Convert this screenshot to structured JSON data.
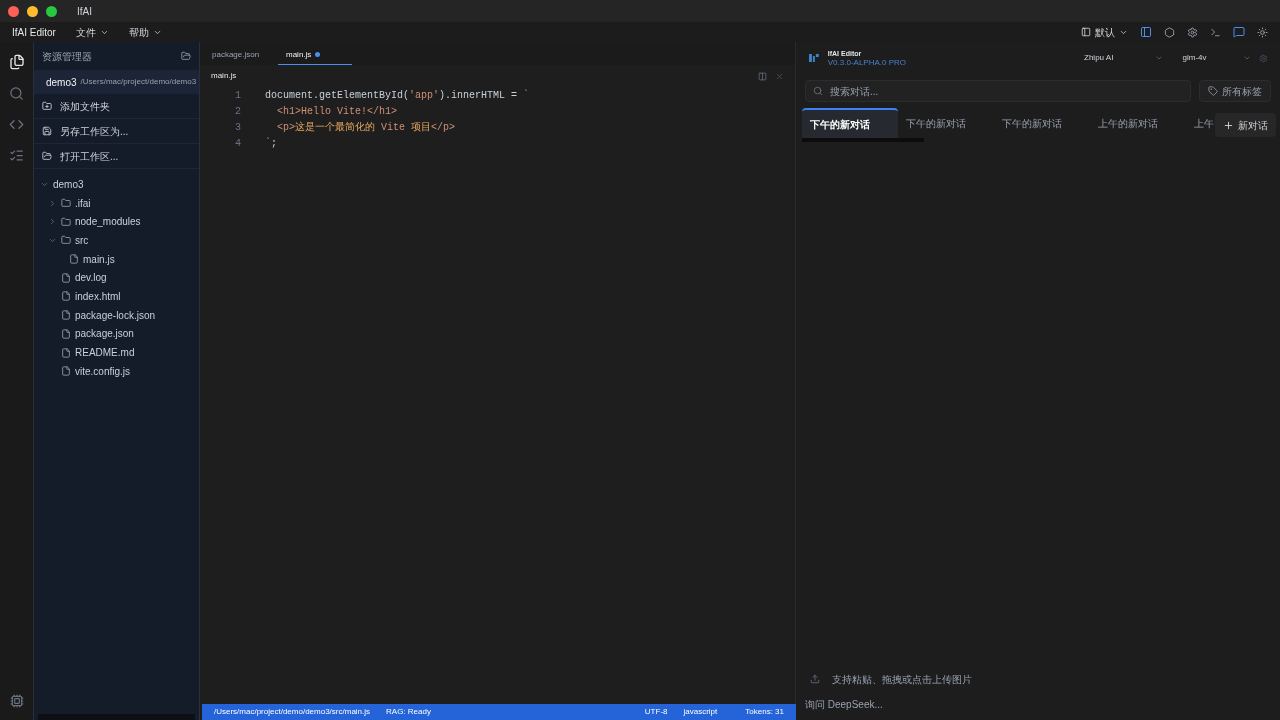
{
  "window": {
    "title": "IfAI"
  },
  "menu_bar": {
    "app_name": "IfAI Editor",
    "menus": [
      "文件",
      "帮助"
    ],
    "layout_select": "默认"
  },
  "sidebar": {
    "title": "资源管理器",
    "workspace": {
      "name": "demo3",
      "path": "/Users/mac/project/demo/demo3"
    },
    "actions": [
      {
        "kind": "add-folder",
        "label": "添加文件夹"
      },
      {
        "kind": "save",
        "label": "另存工作区为..."
      },
      {
        "kind": "open",
        "label": "打开工作区..."
      }
    ],
    "tree": [
      {
        "name": "demo3",
        "kind": "folder",
        "expanded": true,
        "children": [
          {
            "name": ".ifai",
            "kind": "folder",
            "expanded": false
          },
          {
            "name": "node_modules",
            "kind": "folder",
            "expanded": false
          },
          {
            "name": "src",
            "kind": "folder",
            "expanded": true,
            "children": [
              {
                "name": "main.js",
                "kind": "file"
              }
            ]
          },
          {
            "name": "dev.log",
            "kind": "file"
          },
          {
            "name": "index.html",
            "kind": "file"
          },
          {
            "name": "package-lock.json",
            "kind": "file"
          },
          {
            "name": "package.json",
            "kind": "file"
          },
          {
            "name": "README.md",
            "kind": "file"
          },
          {
            "name": "vite.config.js",
            "kind": "file"
          }
        ]
      }
    ]
  },
  "editor": {
    "tabs": [
      {
        "label": "package.json",
        "selected": false,
        "modified": false
      },
      {
        "label": "main.js",
        "selected": true,
        "modified": true
      }
    ],
    "file_title": "main.js",
    "lines": [
      {
        "number": "1",
        "tokens": [
          {
            "kind": "plain",
            "text": "document.getElementById("
          },
          {
            "kind": "string",
            "text": "'app'"
          },
          {
            "kind": "plain",
            "text": ").innerHTML = "
          },
          {
            "kind": "string",
            "text": "`"
          }
        ]
      },
      {
        "number": "2",
        "tokens": [
          {
            "kind": "string",
            "text": "  <h1>Hello Vite!</h1>"
          }
        ]
      },
      {
        "number": "3",
        "tokens": [
          {
            "kind": "string",
            "text": "  <p>"
          },
          {
            "kind": "text",
            "text": "这是一个最简化的"
          },
          {
            "kind": "string",
            "text": " Vite "
          },
          {
            "kind": "text",
            "text": "项目"
          },
          {
            "kind": "string",
            "text": "</p>"
          }
        ]
      },
      {
        "number": "4",
        "tokens": [
          {
            "kind": "string",
            "text": "`"
          },
          {
            "kind": "plain",
            "text": ";"
          }
        ]
      }
    ]
  },
  "status_bar": {
    "path": "/Users/mac/project/demo/demo3/src/main.js",
    "rag": "RAG: Ready",
    "encoding": "UTF-8",
    "language": "javascript",
    "tokens": "Tokens: 31"
  },
  "chat": {
    "app_name": "IfAI Editor",
    "version": "V0.3.0-ALPHA.0 PRO",
    "provider": "Zhipu AI",
    "model": "glm-4v",
    "search": {
      "placeholder": "搜索对话..."
    },
    "tags_button": "所有标签",
    "tabs": [
      {
        "label": "下午的新对话",
        "selected": true
      },
      {
        "label": "下午的新对话",
        "selected": false
      },
      {
        "label": "下午的新对话",
        "selected": false
      },
      {
        "label": "上午的新对话",
        "selected": false
      },
      {
        "label": "上午",
        "selected": false
      }
    ],
    "new_button": "新对话",
    "upload_hint": "支持粘贴、拖拽或点击上传图片",
    "input": {
      "placeholder": "询问 DeepSeek..."
    }
  }
}
